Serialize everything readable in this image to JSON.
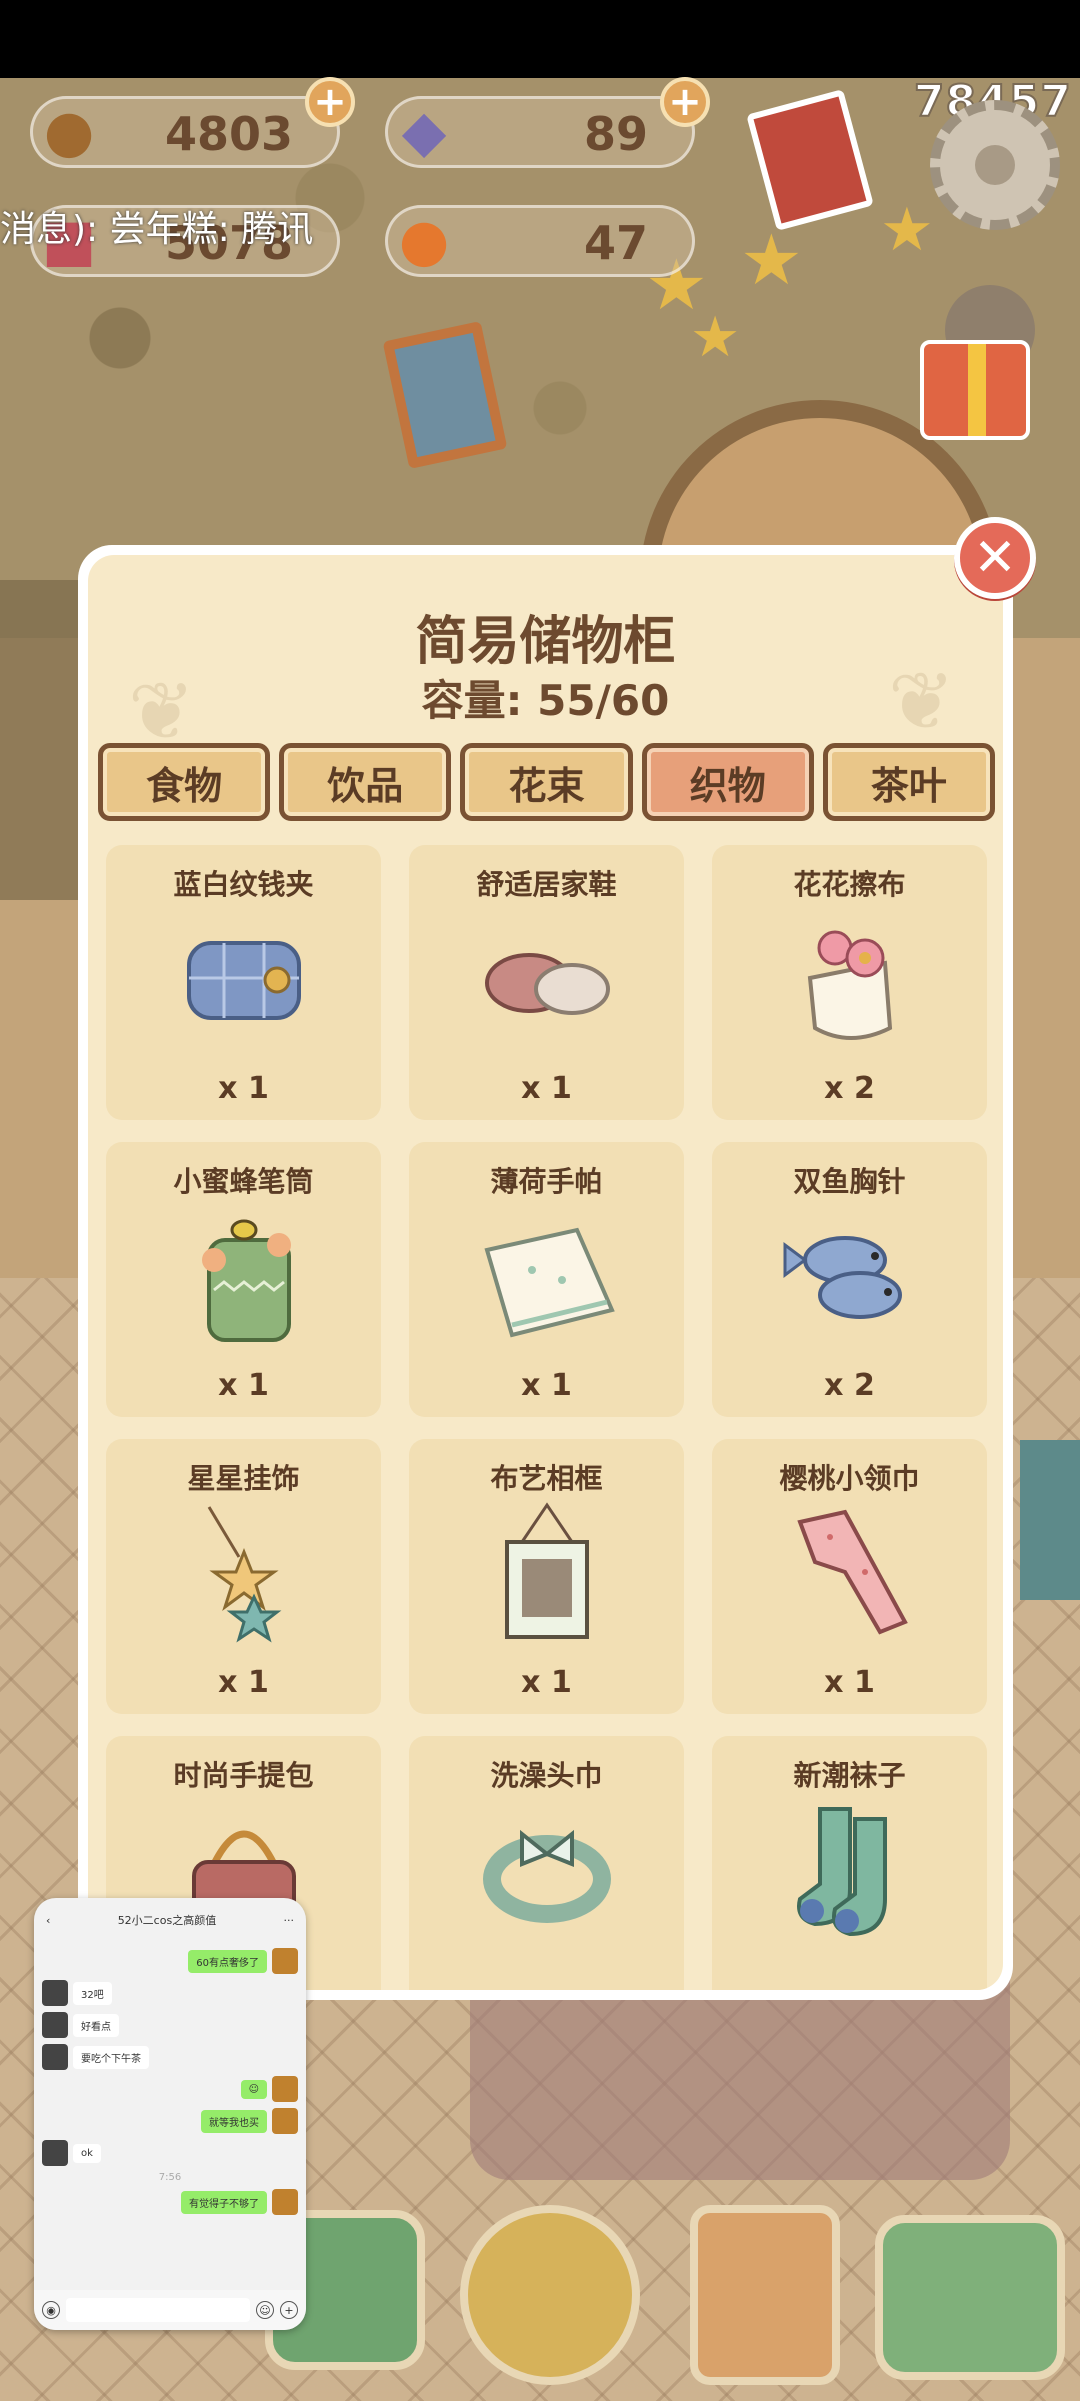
{
  "hud": {
    "acorn": "4803",
    "gem": "89",
    "cake": "5078",
    "orange": "47",
    "score": "78457",
    "ticker": "消息): 尝年糕: 腾讯"
  },
  "panel": {
    "title": "简易储物柜",
    "capacity": "容量: 55/60",
    "tabs": [
      "食物",
      "饮品",
      "花束",
      "织物",
      "茶叶"
    ],
    "active_tab": "织物",
    "items": [
      {
        "name": "蓝白纹钱夹",
        "qty": "x 1",
        "icon": "wallet-icon"
      },
      {
        "name": "舒适居家鞋",
        "qty": "x 1",
        "icon": "slippers-icon"
      },
      {
        "name": "花花擦布",
        "qty": "x 2",
        "icon": "flower-cloth-icon"
      },
      {
        "name": "小蜜蜂笔筒",
        "qty": "x 1",
        "icon": "bee-pen-holder-icon"
      },
      {
        "name": "薄荷手帕",
        "qty": "x 1",
        "icon": "handkerchief-icon"
      },
      {
        "name": "双鱼胸针",
        "qty": "x 2",
        "icon": "fish-brooch-icon"
      },
      {
        "name": "星星挂饰",
        "qty": "x 1",
        "icon": "star-ornament-icon"
      },
      {
        "name": "布艺相框",
        "qty": "x 1",
        "icon": "fabric-frame-icon"
      },
      {
        "name": "樱桃小领巾",
        "qty": "x 1",
        "icon": "neckerchief-icon"
      },
      {
        "name": "时尚手提包",
        "qty": "",
        "icon": "handbag-icon"
      },
      {
        "name": "洗澡头巾",
        "qty": "",
        "icon": "bath-headband-icon"
      },
      {
        "name": "新潮袜子",
        "qty": "",
        "icon": "socks-icon"
      }
    ]
  },
  "chat": {
    "title": "52小二cos之高颜值",
    "messages": [
      {
        "from": "me",
        "text": "60有点奢侈了"
      },
      {
        "from": "other",
        "text": "32吧"
      },
      {
        "from": "other",
        "text": "好看点"
      },
      {
        "from": "other",
        "text": "要吃个下午茶"
      },
      {
        "from": "me",
        "text": "☺"
      },
      {
        "from": "me",
        "text": "就等我也买"
      },
      {
        "from": "other",
        "text": "ok"
      },
      {
        "from": "time",
        "text": "7:56"
      },
      {
        "from": "me",
        "text": "有觉得子不够了"
      }
    ]
  },
  "colors": {
    "panel_bg": "#f7e9c8",
    "tab_active": "#e7a07a",
    "tab": "#e9c689",
    "close": "#e46a59",
    "text_brown": "#6d4a2f"
  }
}
